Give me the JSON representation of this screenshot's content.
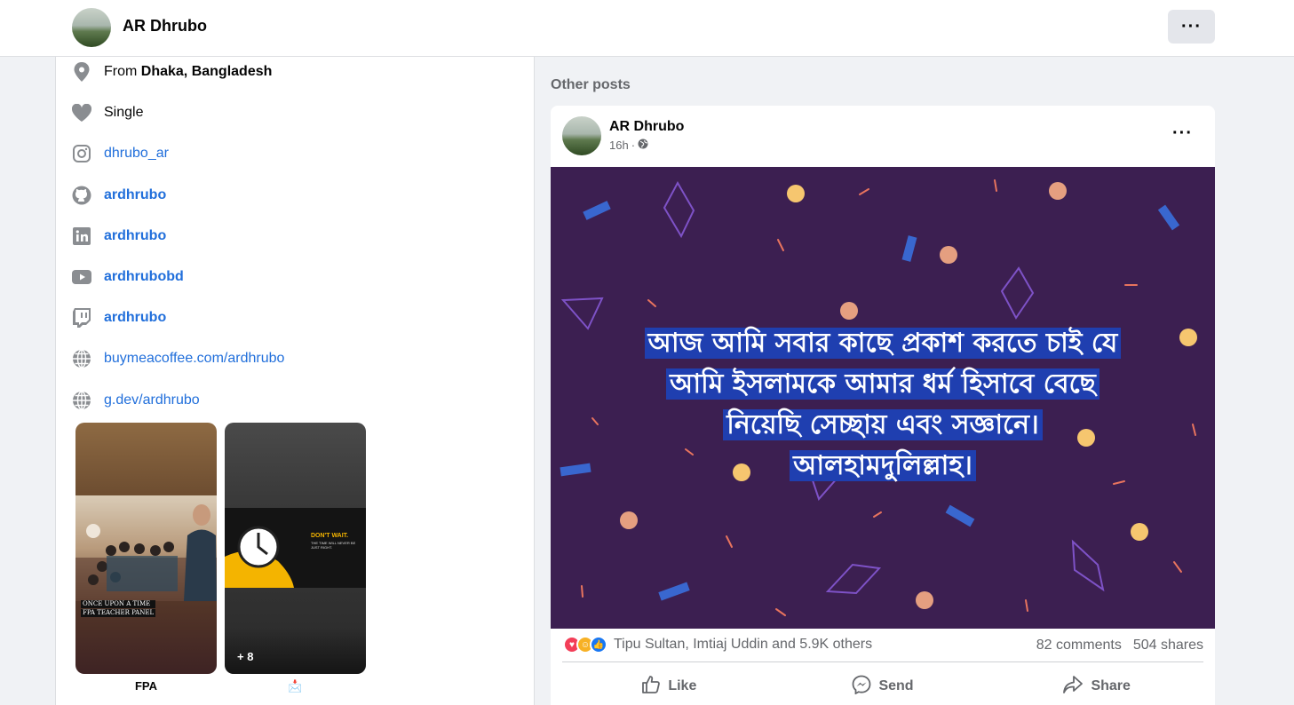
{
  "header": {
    "name": "AR Dhrubo",
    "more_label": "···"
  },
  "intro": {
    "from_prefix": "From ",
    "from_place": "Dhaka, Bangladesh",
    "relationship": "Single",
    "instagram": "dhrubo_ar",
    "github": "ardhrubo",
    "linkedin": "ardhrubo",
    "youtube": "ardhrubobd",
    "twitch": "ardhrubo",
    "website1": "buymeacoffee.com/ardhrubo",
    "website2": "g.dev/ardhrubo"
  },
  "featured": {
    "items": [
      {
        "label": "FPA",
        "caption_line1": "ONCE UPON A TIME",
        "caption_line2": "FPA TEACHER PANEL"
      },
      {
        "label": "📩",
        "overlay_text": "+ 8",
        "title_line1": "DON'T WAIT.",
        "title_line2": "THE TIME WILL NEVER BE",
        "title_line3": "JUST RIGHT."
      }
    ]
  },
  "other_posts": {
    "title": "Other posts",
    "post": {
      "author": "AR Dhrubo",
      "time": "16h",
      "separator": "·",
      "more_label": "···",
      "text_lines": [
        "আজ আমি সবার কাছে প্রকাশ করতে চাই যে",
        "আমি ইসলামকে আমার ধর্ম হিসাবে বেছে",
        "নিয়েছি সেচ্ছায় এবং সজ্ঞানে।",
        "আলহামদুলিল্লাহ।"
      ],
      "reactions_text": "Tipu Sultan, Imtiaj Uddin and 5.9K others",
      "comments": "82 comments",
      "shares": "504 shares",
      "actions": {
        "like": "Like",
        "send": "Send",
        "share": "Share"
      },
      "colors": {
        "background": "#3c1f51",
        "highlight": "#1f3fb0"
      }
    }
  }
}
